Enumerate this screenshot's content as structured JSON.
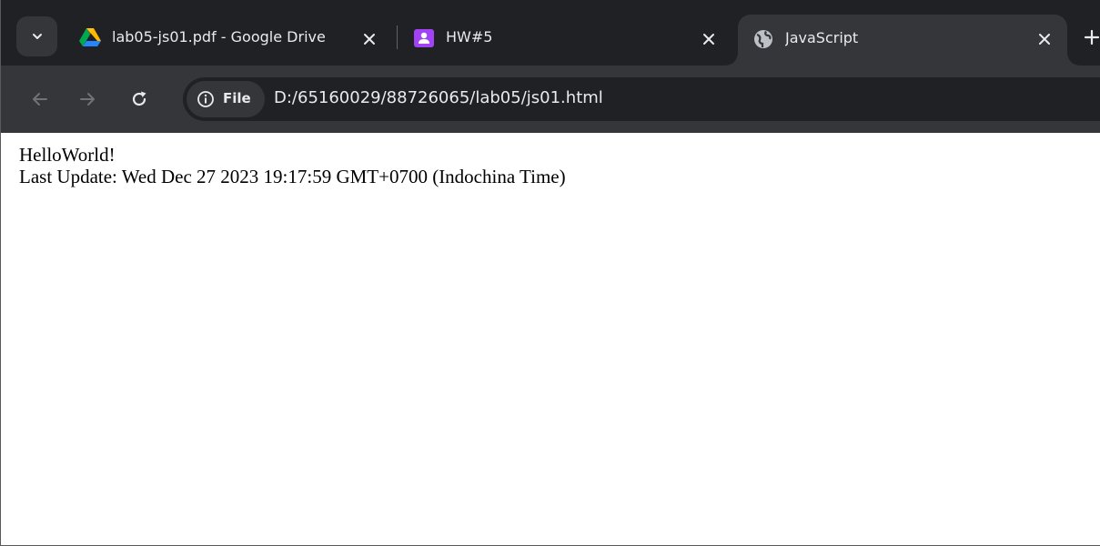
{
  "tabs": [
    {
      "title": "lab05-js01.pdf - Google Drive",
      "favicon": "google-drive-icon"
    },
    {
      "title": "HW#5",
      "favicon": "google-classroom-icon"
    },
    {
      "title": "JavaScript",
      "favicon": "globe-icon",
      "active": true
    }
  ],
  "toolbar": {
    "chip_label": "File",
    "url": "D:/65160029/88726065/lab05/js01.html"
  },
  "page": {
    "line1": "HelloWorld!",
    "line2": "Last Update: Wed Dec 27 2023 19:17:59 GMT+0700 (Indochina Time)"
  },
  "colors": {
    "tabstrip_bg": "#202124",
    "toolbar_bg": "#35363a",
    "text": "#e8eaed",
    "classroom_purple": "#a142f4"
  }
}
